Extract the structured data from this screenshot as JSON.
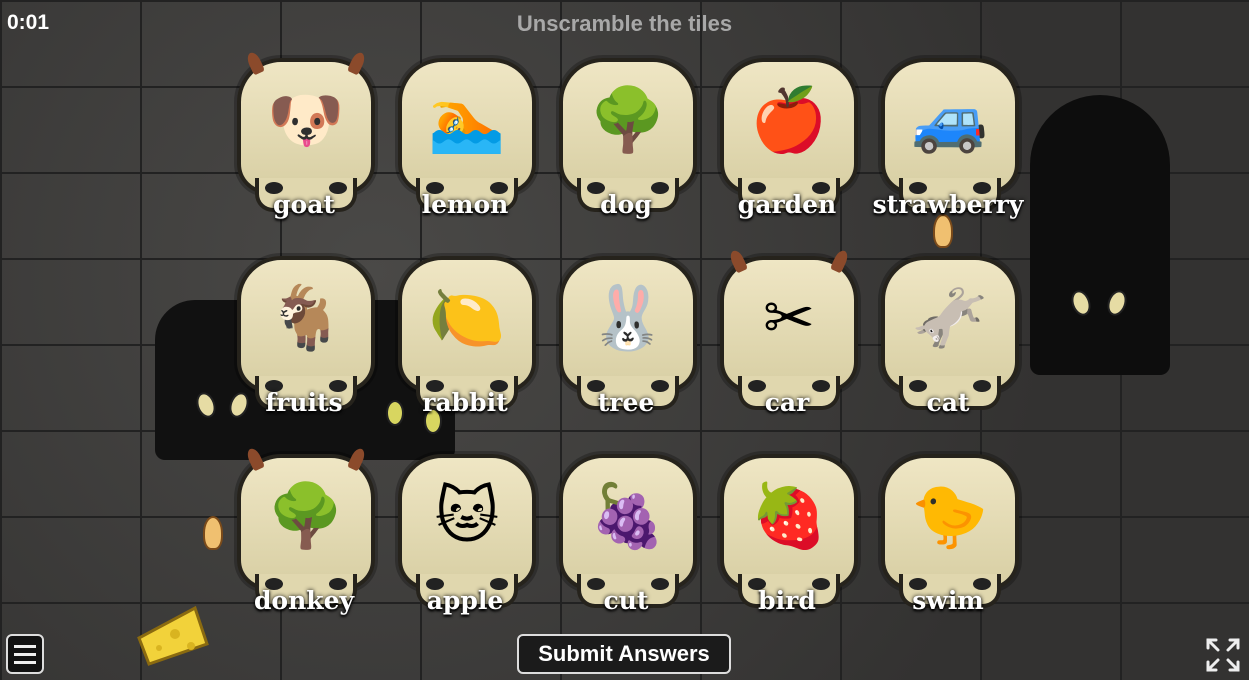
{
  "hud": {
    "timer": "0:01",
    "title": "Unscramble the tiles"
  },
  "tiles": [
    {
      "label": "goat",
      "picture": "dog",
      "glyph": "🐶",
      "horns": true
    },
    {
      "label": "lemon",
      "picture": "swimmer",
      "glyph": "🏊",
      "horns": false
    },
    {
      "label": "dog",
      "picture": "garden",
      "glyph": "🌳",
      "horns": false
    },
    {
      "label": "garden",
      "picture": "apple",
      "glyph": "🍎",
      "horns": false
    },
    {
      "label": "strawberry",
      "picture": "car",
      "glyph": "🚙",
      "horns": false
    },
    {
      "label": "fruits",
      "picture": "goat",
      "glyph": "🐐",
      "horns": false
    },
    {
      "label": "rabbit",
      "picture": "lemon",
      "glyph": "🍋",
      "horns": false
    },
    {
      "label": "tree",
      "picture": "rabbit",
      "glyph": "🐰",
      "horns": false
    },
    {
      "label": "car",
      "picture": "cut",
      "glyph": "✂",
      "horns": true
    },
    {
      "label": "cat",
      "picture": "donkey",
      "glyph": "🫏",
      "horns": false
    },
    {
      "label": "donkey",
      "picture": "tree",
      "glyph": "🌳",
      "horns": true
    },
    {
      "label": "apple",
      "picture": "cat",
      "glyph": "🐱",
      "horns": false
    },
    {
      "label": "cut",
      "picture": "fruits",
      "glyph": "🍇",
      "horns": false
    },
    {
      "label": "bird",
      "picture": "strawberry",
      "glyph": "🍓",
      "horns": false
    },
    {
      "label": "swim",
      "picture": "bird",
      "glyph": "🐤",
      "horns": false
    }
  ],
  "footer": {
    "submit_label": "Submit Answers",
    "menu_icon": "hamburger-menu-icon",
    "fullscreen_icon": "fullscreen-icon"
  },
  "colors": {
    "skull": "#efe6c4",
    "outline": "#26231c",
    "title_text": "#a8a8a8"
  }
}
